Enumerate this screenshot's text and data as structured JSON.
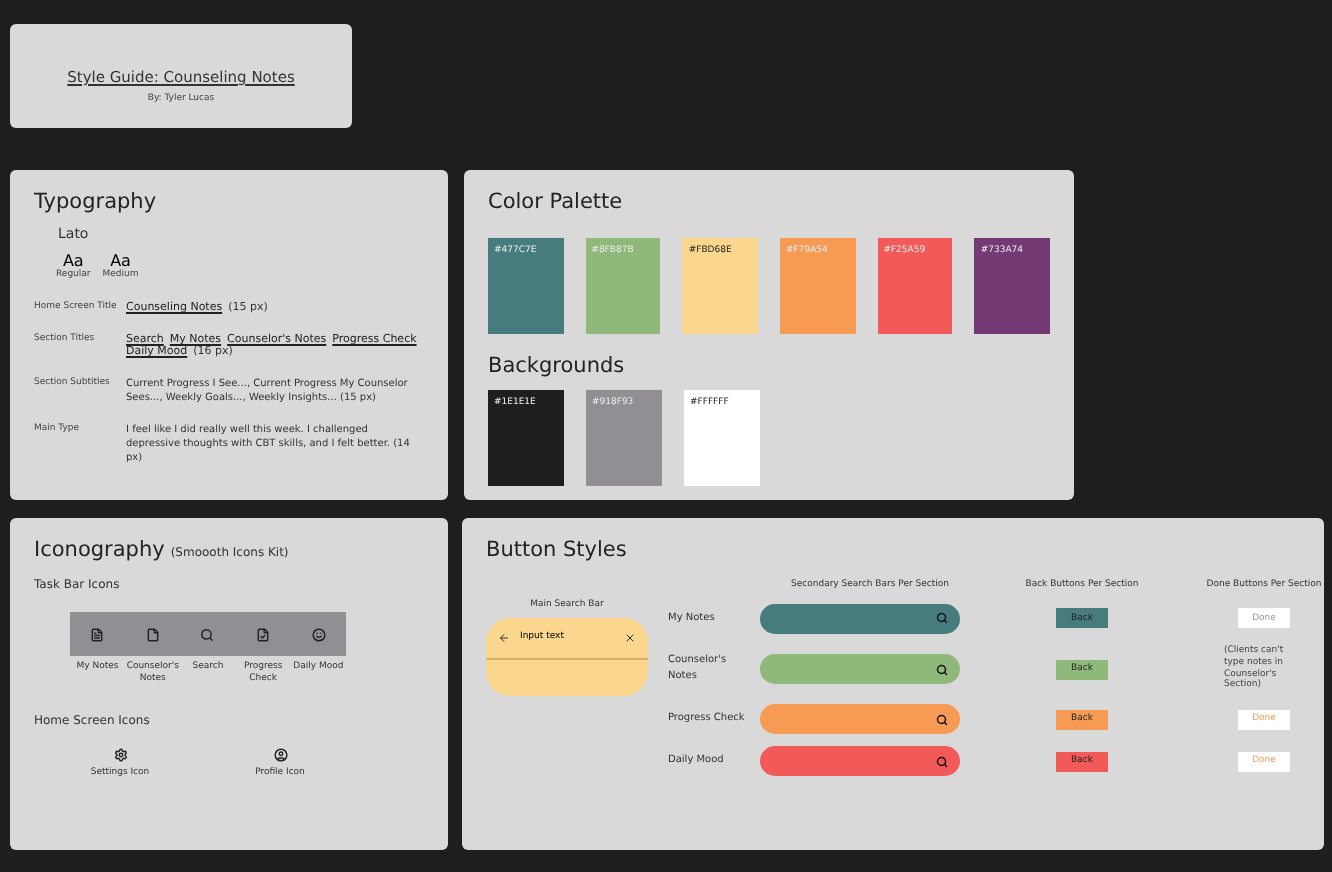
{
  "title_card": {
    "title": "Style Guide: Counseling Notes",
    "author": "By: Tyler Lucas"
  },
  "typography": {
    "title": "Typography",
    "font_name": "Lato",
    "weights": [
      {
        "sample": "Aa",
        "label": "Regular"
      },
      {
        "sample": "Aa",
        "label": "Medium"
      }
    ],
    "rows": [
      {
        "label": "Home Screen Title",
        "links": [
          "Counseling Notes"
        ],
        "size": "(15 px)"
      },
      {
        "label": "Section Titles",
        "links": [
          "Search",
          "My Notes",
          "Counselor's Notes",
          "Progress Check",
          "Daily Mood"
        ],
        "size": "(16 px)"
      },
      {
        "label": "Section Subtitles",
        "text": "Current Progress I See..., Current Progress My Counselor Sees..., Weekly Goals..., Weekly Insights... (15 px)"
      },
      {
        "label": "Main Type",
        "text": "I feel like I did really well this week. I challenged depressive thoughts with CBT skills, and I felt better. (14 px)"
      }
    ]
  },
  "color_palette": {
    "title": "Color Palette",
    "swatches": [
      {
        "label": "#477C7E",
        "color": "#477c7e"
      },
      {
        "label": "#8FB87B",
        "color": "#8fb87b"
      },
      {
        "label": "#FBD68E",
        "color": "#fbd68e"
      },
      {
        "label": "#F79A54",
        "color": "#f79a54"
      },
      {
        "label": "#F25A59",
        "color": "#f25a59"
      },
      {
        "label": "#733A74",
        "color": "#733a74"
      }
    ]
  },
  "backgrounds": {
    "title": "Backgrounds",
    "swatches": [
      {
        "label": "#1E1E1E",
        "color": "#1e1e1e"
      },
      {
        "label": "#918F93",
        "color": "#918f93"
      },
      {
        "label": "#FFFFFF",
        "color": "#ffffff"
      }
    ]
  },
  "iconography": {
    "title": "Iconography",
    "subtitle": "(Smoooth Icons Kit)",
    "taskbar_title": "Task Bar Icons",
    "taskbar": [
      {
        "kind": "notes",
        "label": "My Notes"
      },
      {
        "kind": "file",
        "label": "Counselor's Notes"
      },
      {
        "kind": "search",
        "label": "Search"
      },
      {
        "kind": "check",
        "label": "Progress Check"
      },
      {
        "kind": "mood",
        "label": "Daily Mood"
      }
    ],
    "home_title": "Home Screen Icons",
    "home": [
      {
        "kind": "settings",
        "label": "Settings Icon"
      },
      {
        "kind": "profile",
        "label": "Profile Icon"
      }
    ]
  },
  "button_styles": {
    "title": "Button Styles",
    "main_search": {
      "heading": "Main Search Bar",
      "value": "Input text"
    },
    "secondary_heading": "Secondary Search Bars Per Section",
    "back_heading": "Back Buttons Per Section",
    "done_heading": "Done Buttons Per Section",
    "sections": [
      {
        "label": "My Notes",
        "color": "#477c7e",
        "back": "Back",
        "done": {
          "kind": "button",
          "text": "Done",
          "active": false
        }
      },
      {
        "label": "Counselor's Notes",
        "color": "#8fb87b",
        "back": "Back",
        "done": {
          "kind": "note",
          "text": "(Clients can't type notes in Counselor's Section)"
        }
      },
      {
        "label": "Progress Check",
        "color": "#f79a54",
        "back": "Back",
        "done": {
          "kind": "button",
          "text": "Done",
          "active": true
        }
      },
      {
        "label": "Daily Mood",
        "color": "#f25a59",
        "back": "Back",
        "done": {
          "kind": "button",
          "text": "Done",
          "active": true
        }
      }
    ]
  }
}
